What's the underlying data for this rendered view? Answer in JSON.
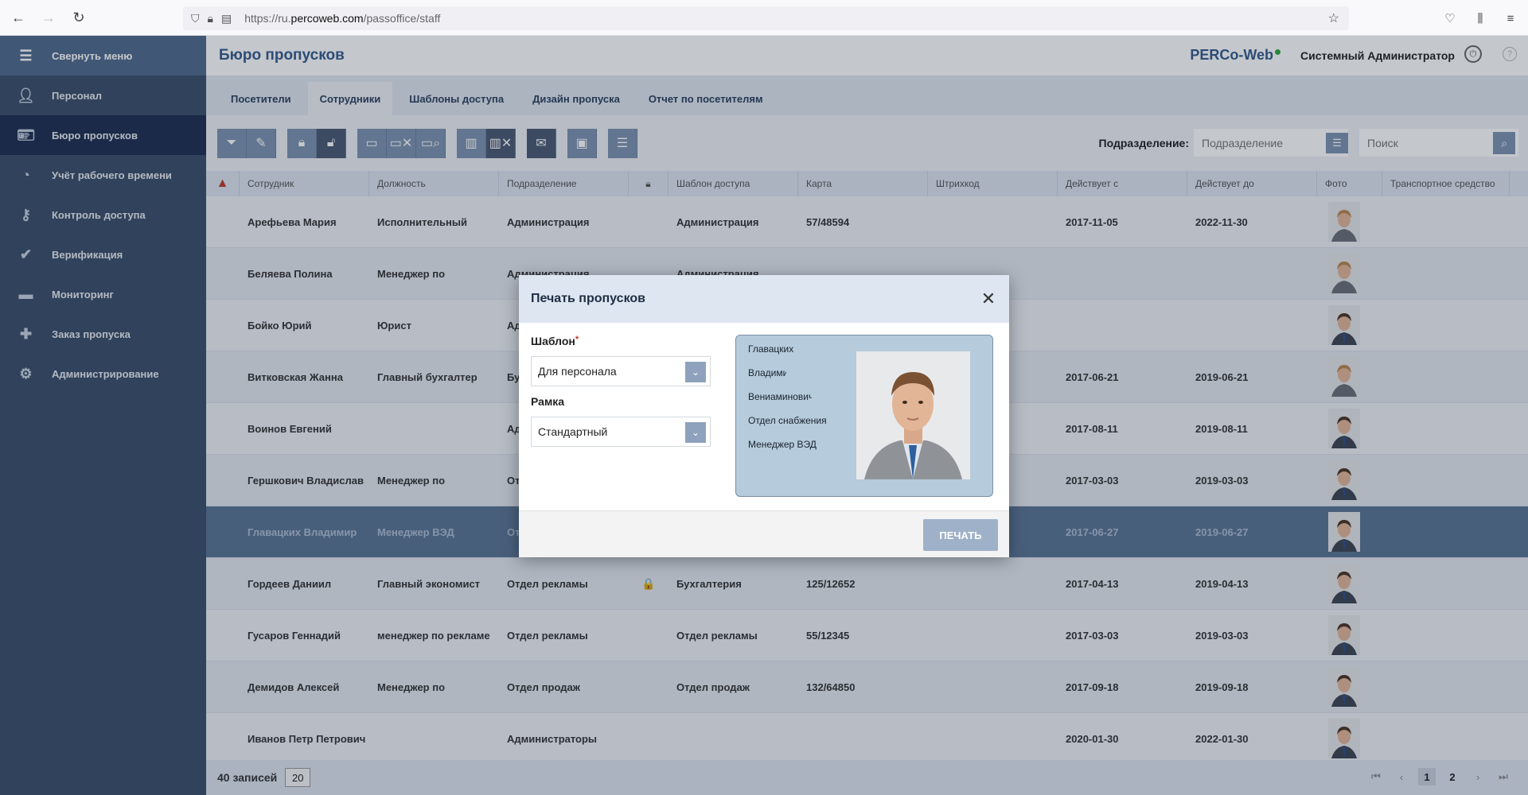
{
  "browser": {
    "url_prefix": "https://ru.",
    "url_domain": "percoweb.com",
    "url_path": "/passoffice/staff"
  },
  "sidebar": {
    "collapse_label": "Свернуть меню",
    "items": [
      {
        "label": "Персонал",
        "icon": "person-icon"
      },
      {
        "label": "Бюро пропусков",
        "icon": "badge-icon"
      },
      {
        "label": "Учёт рабочего времени",
        "icon": "clock-icon"
      },
      {
        "label": "Контроль доступа",
        "icon": "key-icon"
      },
      {
        "label": "Верификация",
        "icon": "verify-icon"
      },
      {
        "label": "Мониторинг",
        "icon": "monitor-icon"
      },
      {
        "label": "Заказ пропуска",
        "icon": "order-icon"
      },
      {
        "label": "Администрирование",
        "icon": "gear-icon"
      }
    ]
  },
  "header": {
    "title": "Бюро пропусков",
    "brand": "PERCo-Web",
    "user": "Системный Администратор"
  },
  "tabs": [
    {
      "label": "Посетители"
    },
    {
      "label": "Сотрудники"
    },
    {
      "label": "Шаблоны доступа"
    },
    {
      "label": "Дизайн пропуска"
    },
    {
      "label": "Отчет по посетителям"
    }
  ],
  "filters": {
    "dept_label": "Подразделение:",
    "dept_placeholder": "Подразделение",
    "search_placeholder": "Поиск"
  },
  "table": {
    "columns": [
      "Сотрудник",
      "Должность",
      "Подразделение",
      "Шаблон доступа",
      "Карта",
      "Штрихкод",
      "Действует с",
      "Действует до",
      "Фото",
      "Транспортное средство"
    ],
    "rows": [
      {
        "name": "Арефьева Мария",
        "position": "Исполнительный",
        "dept": "Администрация",
        "template": "Администрация",
        "card": "57/48594",
        "from": "2017-11-05",
        "to": "2022-11-30",
        "locked": ""
      },
      {
        "name": "Беляева Полина",
        "position": "Менеджер по",
        "dept": "Администрация",
        "template": "Администрация",
        "card": "",
        "from": "",
        "to": "",
        "locked": ""
      },
      {
        "name": "Бойко Юрий",
        "position": "Юрист",
        "dept": "Администрация",
        "template": "",
        "card": "",
        "from": "",
        "to": "",
        "locked": ""
      },
      {
        "name": "Витковская Жанна",
        "position": "Главный бухгалтер",
        "dept": "Бухгалтерия",
        "template": "",
        "card": "",
        "from": "2017-06-21",
        "to": "2019-06-21",
        "locked": ""
      },
      {
        "name": "Воинов Евгений",
        "position": "",
        "dept": "Администрация",
        "template": "",
        "card": "",
        "from": "2017-08-11",
        "to": "2019-08-11",
        "locked": ""
      },
      {
        "name": "Гершкович Владислав",
        "position": "Менеджер по",
        "dept": "Отдел продаж",
        "template": "",
        "card": "",
        "from": "2017-03-03",
        "to": "2019-03-03",
        "locked": ""
      },
      {
        "name": "Главацких Владимир",
        "position": "Менеджер ВЭД",
        "dept": "Отдел снабжения",
        "template": "",
        "card": "",
        "from": "2017-06-27",
        "to": "2019-06-27",
        "locked": ""
      },
      {
        "name": "Гордеев Даниил",
        "position": "Главный экономист",
        "dept": "Отдел рекламы",
        "template": "Бухгалтерия",
        "card": "125/12652",
        "from": "2017-04-13",
        "to": "2019-04-13",
        "locked": "🔒"
      },
      {
        "name": "Гусаров Геннадий",
        "position": "менеджер по рекламе",
        "dept": "Отдел рекламы",
        "template": "Отдел рекламы",
        "card": "55/12345",
        "from": "2017-03-03",
        "to": "2019-03-03",
        "locked": ""
      },
      {
        "name": "Демидов Алексей",
        "position": "Менеджер по",
        "dept": "Отдел продаж",
        "template": "Отдел продаж",
        "card": "132/64850",
        "from": "2017-09-18",
        "to": "2019-09-18",
        "locked": ""
      },
      {
        "name": "Иванов Петр Петрович",
        "position": "",
        "dept": "Администраторы",
        "template": "",
        "card": "",
        "from": "2020-01-30",
        "to": "2022-01-30",
        "locked": ""
      }
    ]
  },
  "footer": {
    "count": "40 записей",
    "page_size": "20",
    "pages": [
      "1",
      "2"
    ]
  },
  "modal": {
    "title": "Печать пропусков",
    "template_label": "Шаблон",
    "template_value": "Для персонала",
    "frame_label": "Рамка",
    "frame_value": "Стандартный",
    "card_lines": [
      "Главацких",
      "Владими",
      "Вениаминович",
      "Отдел снабжения",
      "Менеджер ВЭД"
    ],
    "print_label": "ПЕЧАТЬ"
  },
  "colors": {
    "sidebar": "#3a4e6a",
    "sidebar_active": "#1d2e4f",
    "accent": "#345b8c",
    "selected_row": "#5a7494",
    "button": "#7e93b0"
  }
}
